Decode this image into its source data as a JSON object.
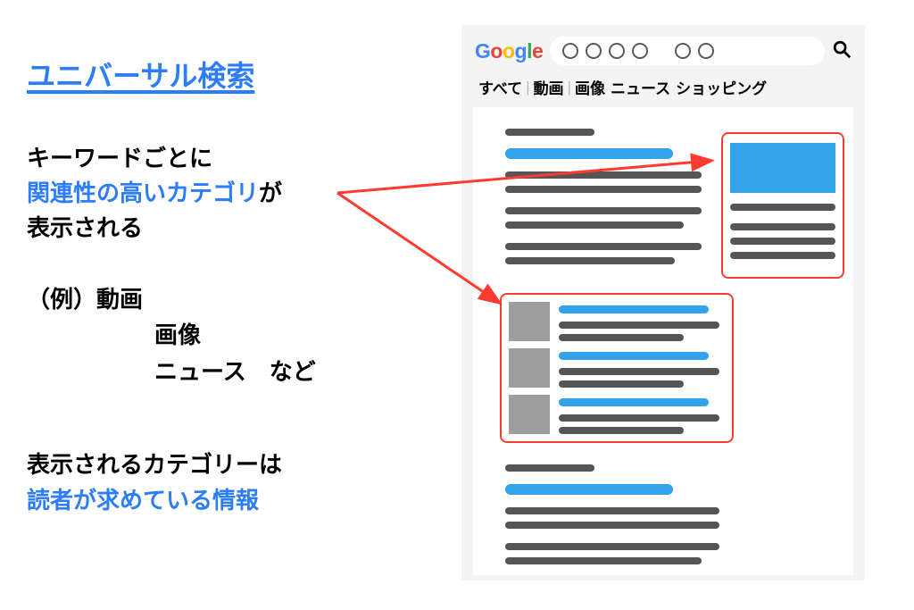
{
  "title": "ユニバーサル検索",
  "p1": {
    "line1": "キーワードごとに",
    "highlight": "関連性の高いカテゴリ",
    "line1_suffix": "が",
    "line2": "表示される"
  },
  "example": {
    "label": "（例）",
    "item1": "動画",
    "item2": "画像",
    "item3": "ニュース",
    "item3_suffix": "　など"
  },
  "p2": {
    "line1": "表示されるカテゴリーは",
    "highlight": "読者が求めている情報"
  },
  "mock": {
    "logo": {
      "g": "G",
      "o1": "o",
      "o2": "o",
      "g2": "g",
      "l": "l",
      "e": "e"
    },
    "query_circles": "○○○○　○○",
    "tabs": {
      "all": "すべて",
      "video": "動画",
      "image": "画像",
      "news": "ニュース",
      "shopping": "ショッピング"
    }
  }
}
